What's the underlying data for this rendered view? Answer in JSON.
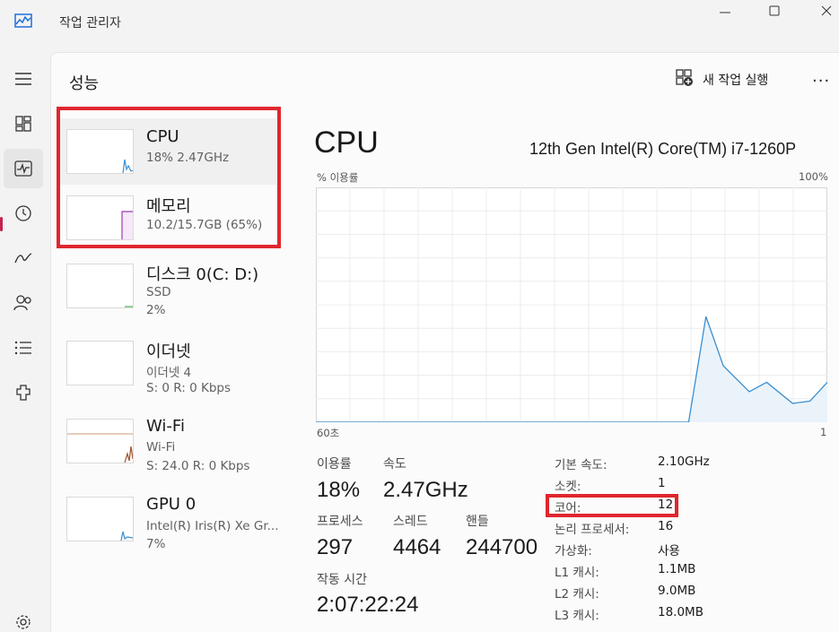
{
  "window": {
    "title": "작업 관리자"
  },
  "header": {
    "page_title": "성능",
    "new_task_label": "새 작업 실행",
    "more_label": "···"
  },
  "rail": [
    "menu-icon",
    "processes-icon",
    "performance-icon",
    "history-icon",
    "startup-icon",
    "users-icon",
    "details-icon",
    "services-icon",
    "settings-icon"
  ],
  "perf_list": [
    {
      "name": "CPU",
      "sub1": "18%  2.47GHz",
      "sub2": ""
    },
    {
      "name": "메모리",
      "sub1": "10.2/15.7GB (65%)",
      "sub2": ""
    },
    {
      "name": "디스크 0(C: D:)",
      "sub1": "SSD",
      "sub2": "2%"
    },
    {
      "name": "이더넷",
      "sub1": "이더넷 4",
      "sub2": "S: 0  R: 0 Kbps"
    },
    {
      "name": "Wi-Fi",
      "sub1": "Wi-Fi",
      "sub2": "S: 24.0  R: 0 Kbps"
    },
    {
      "name": "GPU 0",
      "sub1": "Intel(R) Iris(R) Xe Gr...",
      "sub2": "7%"
    }
  ],
  "detail": {
    "title": "CPU",
    "model": "12th Gen Intel(R) Core(TM) i7-1260P",
    "graph_label": "% 이용률",
    "graph_max": "100%",
    "graph_time_left": "60초",
    "graph_time_right": "1",
    "stats": {
      "usage_label": "이용률",
      "usage_value": "18%",
      "speed_label": "속도",
      "speed_value": "2.47GHz",
      "processes_label": "프로세스",
      "processes_value": "297",
      "threads_label": "스레드",
      "threads_value": "4464",
      "handles_label": "핸들",
      "handles_value": "244700",
      "uptime_label": "작동 시간",
      "uptime_value": "2:07:22:24"
    },
    "specs": [
      {
        "key": "기본 속도:",
        "value": "2.10GHz"
      },
      {
        "key": "소켓:",
        "value": "1"
      },
      {
        "key": "코어:",
        "value": "12"
      },
      {
        "key": "논리 프로세서:",
        "value": "16"
      },
      {
        "key": "가상화:",
        "value": "사용"
      },
      {
        "key": "L1 캐시:",
        "value": "1.1MB"
      },
      {
        "key": "L2 캐시:",
        "value": "9.0MB"
      },
      {
        "key": "L3 캐시:",
        "value": "18.0MB"
      }
    ]
  },
  "colors": {
    "cpu": "#3c8fd0",
    "memory": "#9a3fb0",
    "disk": "#4caf50",
    "wifi": "#a0522d",
    "highlight": "#e0262e",
    "accent": "#c4214a"
  },
  "chart_data": {
    "type": "area",
    "title": "",
    "ylabel": "% 이용률",
    "ylim": [
      0,
      100
    ],
    "xlim": [
      60,
      1
    ],
    "x": [
      60,
      55,
      50,
      45,
      40,
      35,
      30,
      25,
      20,
      17,
      15,
      13,
      10,
      8,
      5,
      3,
      1
    ],
    "values": [
      0,
      0,
      0,
      0,
      0,
      0,
      0,
      0,
      0,
      0,
      45,
      24,
      13,
      17,
      8,
      9,
      17
    ]
  }
}
